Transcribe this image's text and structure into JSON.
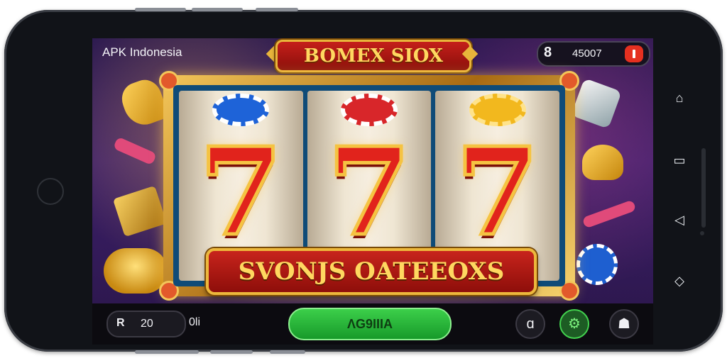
{
  "app": {
    "brand": "APK Indonesia",
    "title": "BOMEX SIOX",
    "counter": {
      "icon": "8",
      "value": "45007",
      "action_icon": "pause-icon"
    }
  },
  "reels": [
    {
      "top_symbol": "blue-chip",
      "main_symbol": "7"
    },
    {
      "top_symbol": "red-chip",
      "main_symbol": "7"
    },
    {
      "top_symbol": "gold-chip",
      "main_symbol": "7"
    }
  ],
  "win_banner": "SVONJS OATEEOXS",
  "bottom_bar": {
    "bet_icon": "R",
    "bet_value": "20",
    "bet_unit": "0li",
    "spin_label": "ΛG9IIIA",
    "buttons": [
      "info-icon",
      "settings-icon",
      "profile-icon"
    ]
  },
  "nav_icons": [
    "home-icon",
    "recent-icon",
    "back-icon",
    "rotate-icon"
  ],
  "colors": {
    "accent_green": "#2fbf3f",
    "title_red": "#c51f1a",
    "gold": "#e8b53b",
    "bg": "#2a1850"
  }
}
